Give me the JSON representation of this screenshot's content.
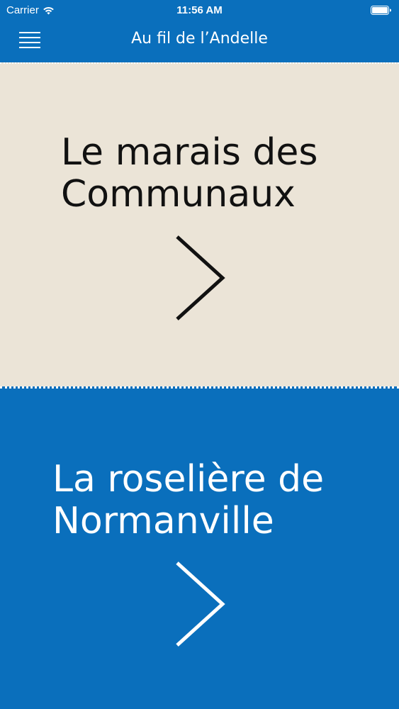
{
  "status_bar": {
    "carrier": "Carrier",
    "time": "11:56 AM",
    "icons": [
      "wifi-icon",
      "battery-icon"
    ]
  },
  "nav": {
    "title": "Au fil de l’Andelle",
    "menu_icon": "hamburger-menu-icon"
  },
  "cards": [
    {
      "title": "Le marais des\nCommunaux",
      "background": "#ebe4d7",
      "text_color": "#111111",
      "icon": "chevron-right-icon"
    },
    {
      "title": "La roselière de\nNormanville",
      "background": "#0a6fbc",
      "text_color": "#ffffff",
      "icon": "chevron-right-icon"
    }
  ],
  "colors": {
    "brand_blue": "#0a6fbc",
    "sand": "#ebe4d7"
  }
}
